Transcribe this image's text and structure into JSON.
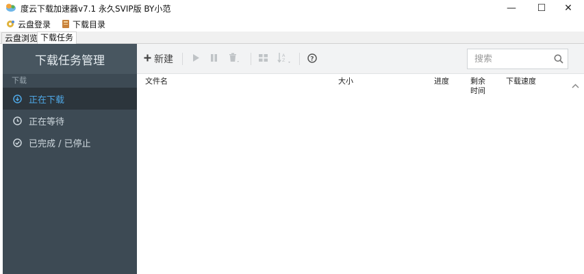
{
  "window": {
    "title": "度云下载加速器v7.1 永久SVIP版 BY小范",
    "minimize": "—",
    "maximize": "☐",
    "close": "✕"
  },
  "menu": {
    "items": [
      {
        "label": "云盘登录",
        "icon": "gear-star-icon"
      },
      {
        "label": "下载目录",
        "icon": "folder-icon"
      }
    ]
  },
  "tabs": [
    {
      "label": "云盘浏览",
      "active": false
    },
    {
      "label": "下载任务",
      "active": true
    }
  ],
  "sidebar": {
    "title": "下载任务管理",
    "section_label": "下载",
    "items": [
      {
        "label": "正在下载",
        "icon": "download-circle-icon",
        "active": true
      },
      {
        "label": "正在等待",
        "icon": "clock-icon",
        "active": false
      },
      {
        "label": "已完成 / 已停止",
        "icon": "check-circle-icon",
        "active": false
      }
    ]
  },
  "toolbar": {
    "new_label": "新建",
    "buttons": [
      "play-icon",
      "pause-icon",
      "trash-icon",
      "grid-icon",
      "sort-az-icon",
      "help-icon"
    ]
  },
  "search": {
    "placeholder": "搜索",
    "value": ""
  },
  "table": {
    "columns": [
      "文件名",
      "大小",
      "进度",
      "剩余\n时间",
      "下载速度"
    ],
    "rows": []
  },
  "colors": {
    "sidebar_bg": "#3d4a54",
    "sidebar_header_bg": "#485660",
    "sidebar_active_bg": "#2c353c",
    "accent": "#4fa8e6",
    "toolbar_bg": "#f2f3f4"
  }
}
